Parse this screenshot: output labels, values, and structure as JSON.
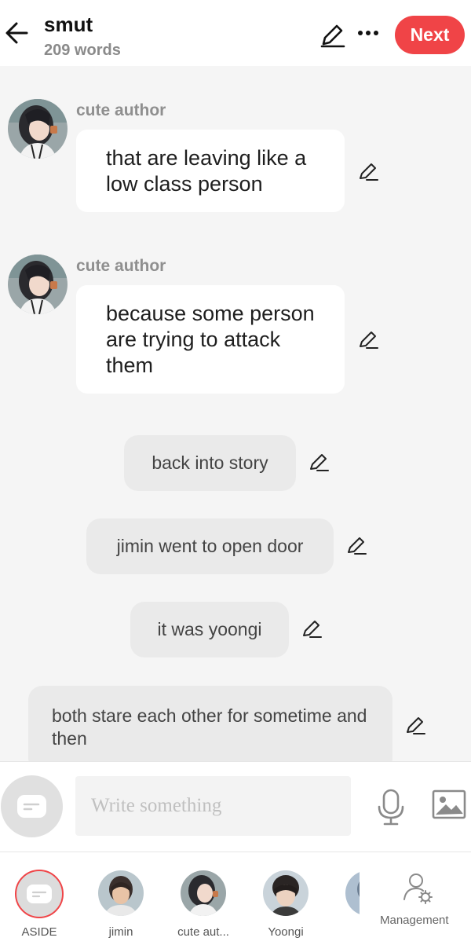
{
  "header": {
    "title": "smut",
    "word_count": "209 words",
    "next_label": "Next"
  },
  "messages": [
    {
      "type": "character",
      "author": "cute author",
      "text": "that are leaving like a low class person"
    },
    {
      "type": "character",
      "author": "cute author",
      "text": "because some person are trying to attack them"
    },
    {
      "type": "aside",
      "text": "back into story"
    },
    {
      "type": "aside",
      "text": "jimin went to open door"
    },
    {
      "type": "aside",
      "text": "it was yoongi"
    },
    {
      "type": "aside",
      "text": "both stare each other for sometime and then"
    }
  ],
  "composer": {
    "placeholder": "Write something"
  },
  "characters": [
    {
      "label": "ASIDE",
      "selected": true
    },
    {
      "label": "jimin"
    },
    {
      "label": "cute aut..."
    },
    {
      "label": "Yoongi"
    }
  ],
  "management_label": "Management",
  "colors": {
    "accent": "#f04447",
    "aside_bubble": "#eaeaea",
    "background": "#f5f5f5"
  }
}
